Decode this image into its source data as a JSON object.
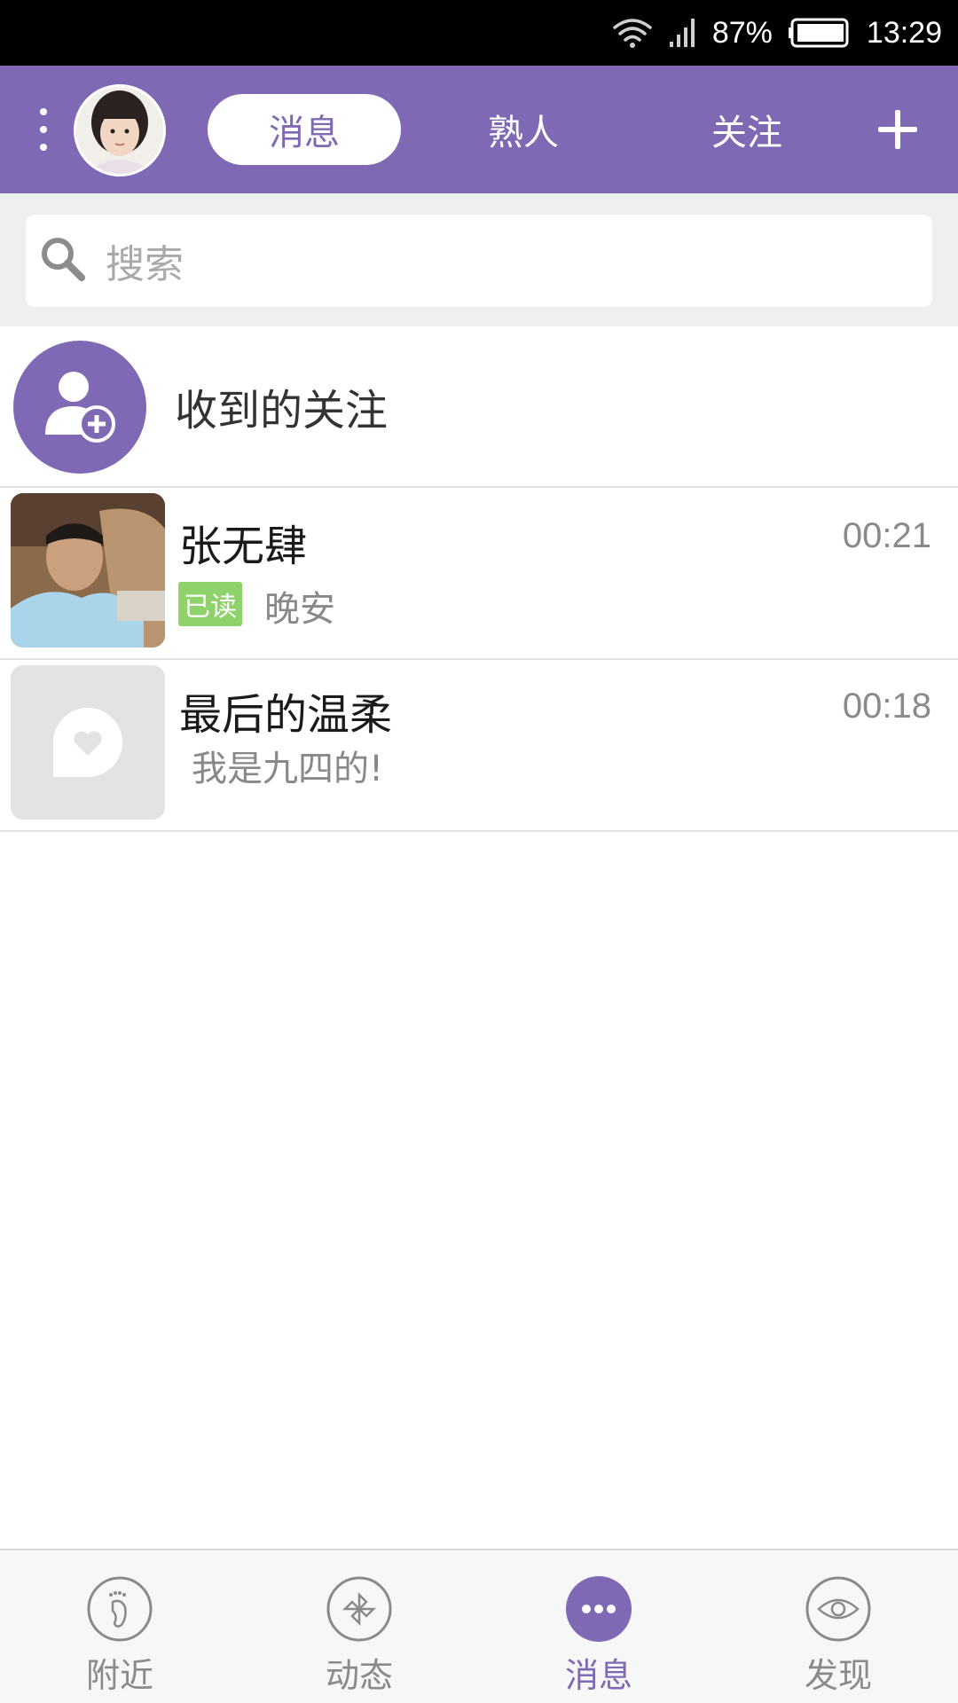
{
  "status_bar": {
    "battery_percent": "87%",
    "time": "13:29",
    "icons": [
      "wifi-icon",
      "signal-icon",
      "battery-icon"
    ]
  },
  "header": {
    "tabs": [
      {
        "label": "消息",
        "active": true
      },
      {
        "label": "熟人",
        "active": false
      },
      {
        "label": "关注",
        "active": false
      }
    ],
    "icons": [
      "menu-dots-icon",
      "plus-icon"
    ]
  },
  "search": {
    "placeholder": "搜索"
  },
  "follow_notice": {
    "label": "收到的关注"
  },
  "conversations": [
    {
      "name": "张无肆",
      "time": "00:21",
      "read_badge": "已读",
      "preview": "晚安"
    },
    {
      "name": "最后的温柔",
      "time": "00:18",
      "preview": "我是九四的!"
    }
  ],
  "bottom_nav": {
    "items": [
      {
        "label": "附近",
        "icon": "footprint-icon",
        "active": false
      },
      {
        "label": "动态",
        "icon": "pinwheel-icon",
        "active": false
      },
      {
        "label": "消息",
        "icon": "chat-dots-icon",
        "active": true
      },
      {
        "label": "发现",
        "icon": "eye-icon",
        "active": false
      }
    ]
  },
  "colors": {
    "accent": "#7f69b5",
    "read_badge": "#8fd16a",
    "search_background": "#efefef"
  }
}
